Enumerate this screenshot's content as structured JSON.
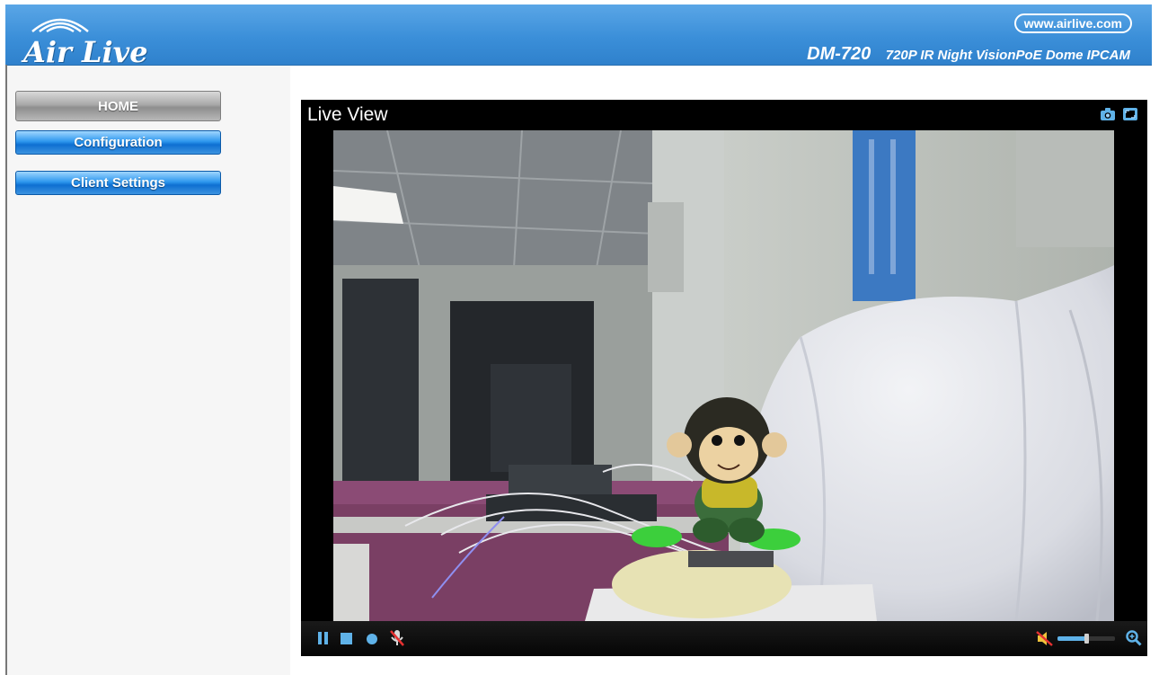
{
  "header": {
    "brand": "Air Live",
    "url": "www.airlive.com",
    "model": "DM-720",
    "model_desc": "720P IR Night VisionPoE Dome IPCAM"
  },
  "nav": {
    "home": "HOME",
    "configuration": "Configuration",
    "client_settings": "Client Settings"
  },
  "live_view": {
    "title": "Live View",
    "icons": [
      "camera-snapshot-icon",
      "fullscreen-icon"
    ],
    "controls": [
      "pause-icon",
      "stop-icon",
      "record-icon",
      "microphone-muted-icon",
      "speaker-muted-icon",
      "zoom-in-icon"
    ],
    "volume_level": 0.5
  },
  "colors": {
    "header_blue": "#3b8fd9",
    "button_blue": "#1e86e0",
    "home_gray": "#a9a9a9"
  }
}
